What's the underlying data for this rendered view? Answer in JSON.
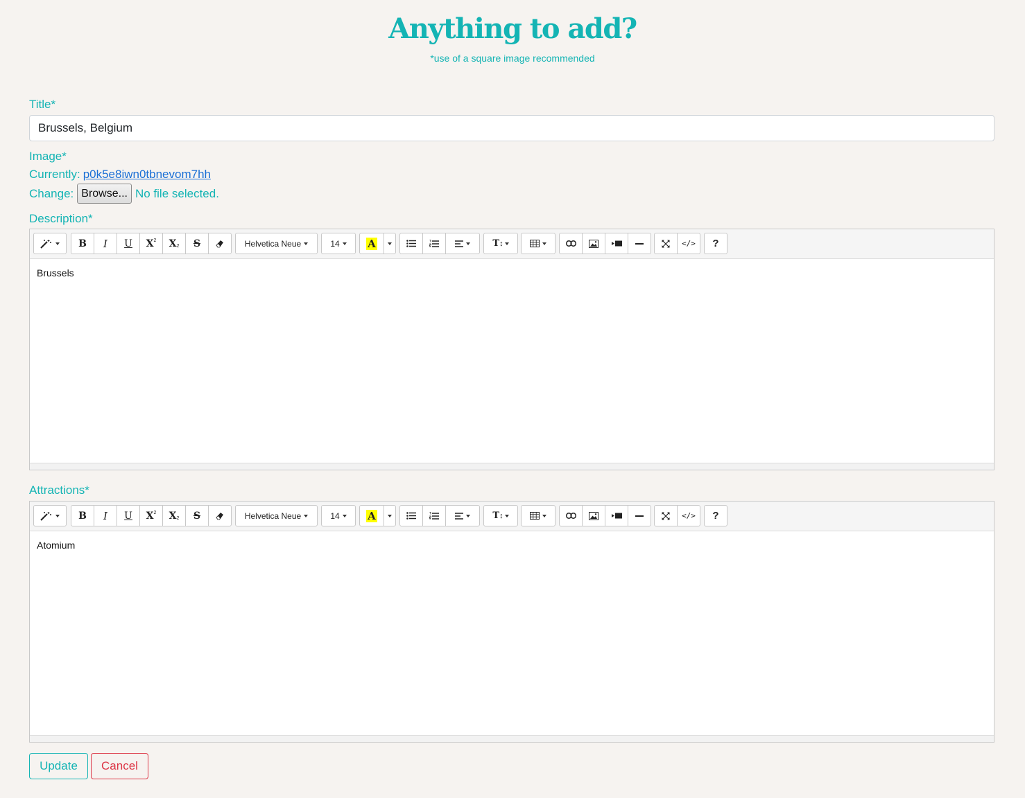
{
  "header": {
    "title": "Anything to add?",
    "subtitle": "*use of a square image recommended"
  },
  "form": {
    "title_label": "Title*",
    "title_value": "Brussels, Belgium",
    "image_label": "Image*",
    "currently_label": "Currently:",
    "currently_link": "p0k5e8iwn0tbnevom7hh",
    "change_label": "Change:",
    "browse_label": "Browse...",
    "no_file_text": "No file selected.",
    "description_label": "Description*",
    "description_content": "Brussels",
    "attractions_label": "Attractions*",
    "attractions_content": "Atomium",
    "update_label": "Update",
    "cancel_label": "Cancel"
  },
  "toolbar": {
    "font_name": "Helvetica Neue",
    "font_size": "14",
    "color_letter": "A",
    "help_label": "?",
    "icons": [
      "magic-icon",
      "bold-icon",
      "italic-icon",
      "underline-icon",
      "superscript-icon",
      "subscript-icon",
      "strikethrough-icon",
      "eraser-icon",
      "font-color-icon",
      "unordered-list-icon",
      "ordered-list-icon",
      "align-icon",
      "line-height-icon",
      "table-icon",
      "link-icon",
      "picture-icon",
      "video-icon",
      "horizontal-rule-icon",
      "fullscreen-icon",
      "code-view-icon",
      "help-icon"
    ]
  },
  "colors": {
    "accent": "#14b4b4",
    "link": "#1a6fd6",
    "danger": "#dc3545",
    "background": "#f6f3f0",
    "highlight": "#ffff00"
  }
}
